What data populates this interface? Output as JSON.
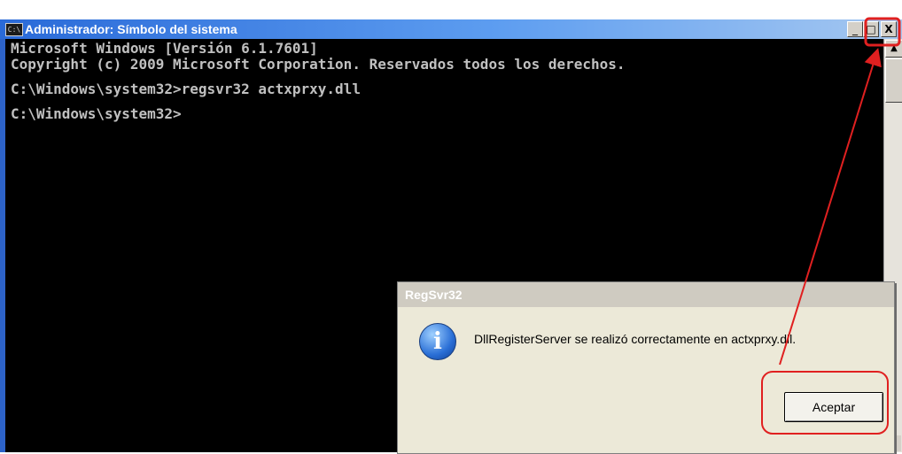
{
  "console": {
    "title": "Administrador: Símbolo del sistema",
    "icon_label": "C:\\",
    "window_buttons": {
      "minimize": "_",
      "maximize": "□",
      "close": "X"
    },
    "lines": [
      "Microsoft Windows [Versión 6.1.7601]",
      "Copyright (c) 2009 Microsoft Corporation. Reservados todos los derechos.",
      "",
      "C:\\Windows\\system32>regsvr32 actxprxy.dll",
      "",
      "C:\\Windows\\system32>"
    ]
  },
  "dialog": {
    "title": "RegSvr32",
    "message": "DllRegisterServer se realizó correctamente en actxprxy.dll.",
    "ok_label": "Aceptar",
    "icon": "info-icon"
  },
  "annotations": {
    "color": "#e02020"
  }
}
